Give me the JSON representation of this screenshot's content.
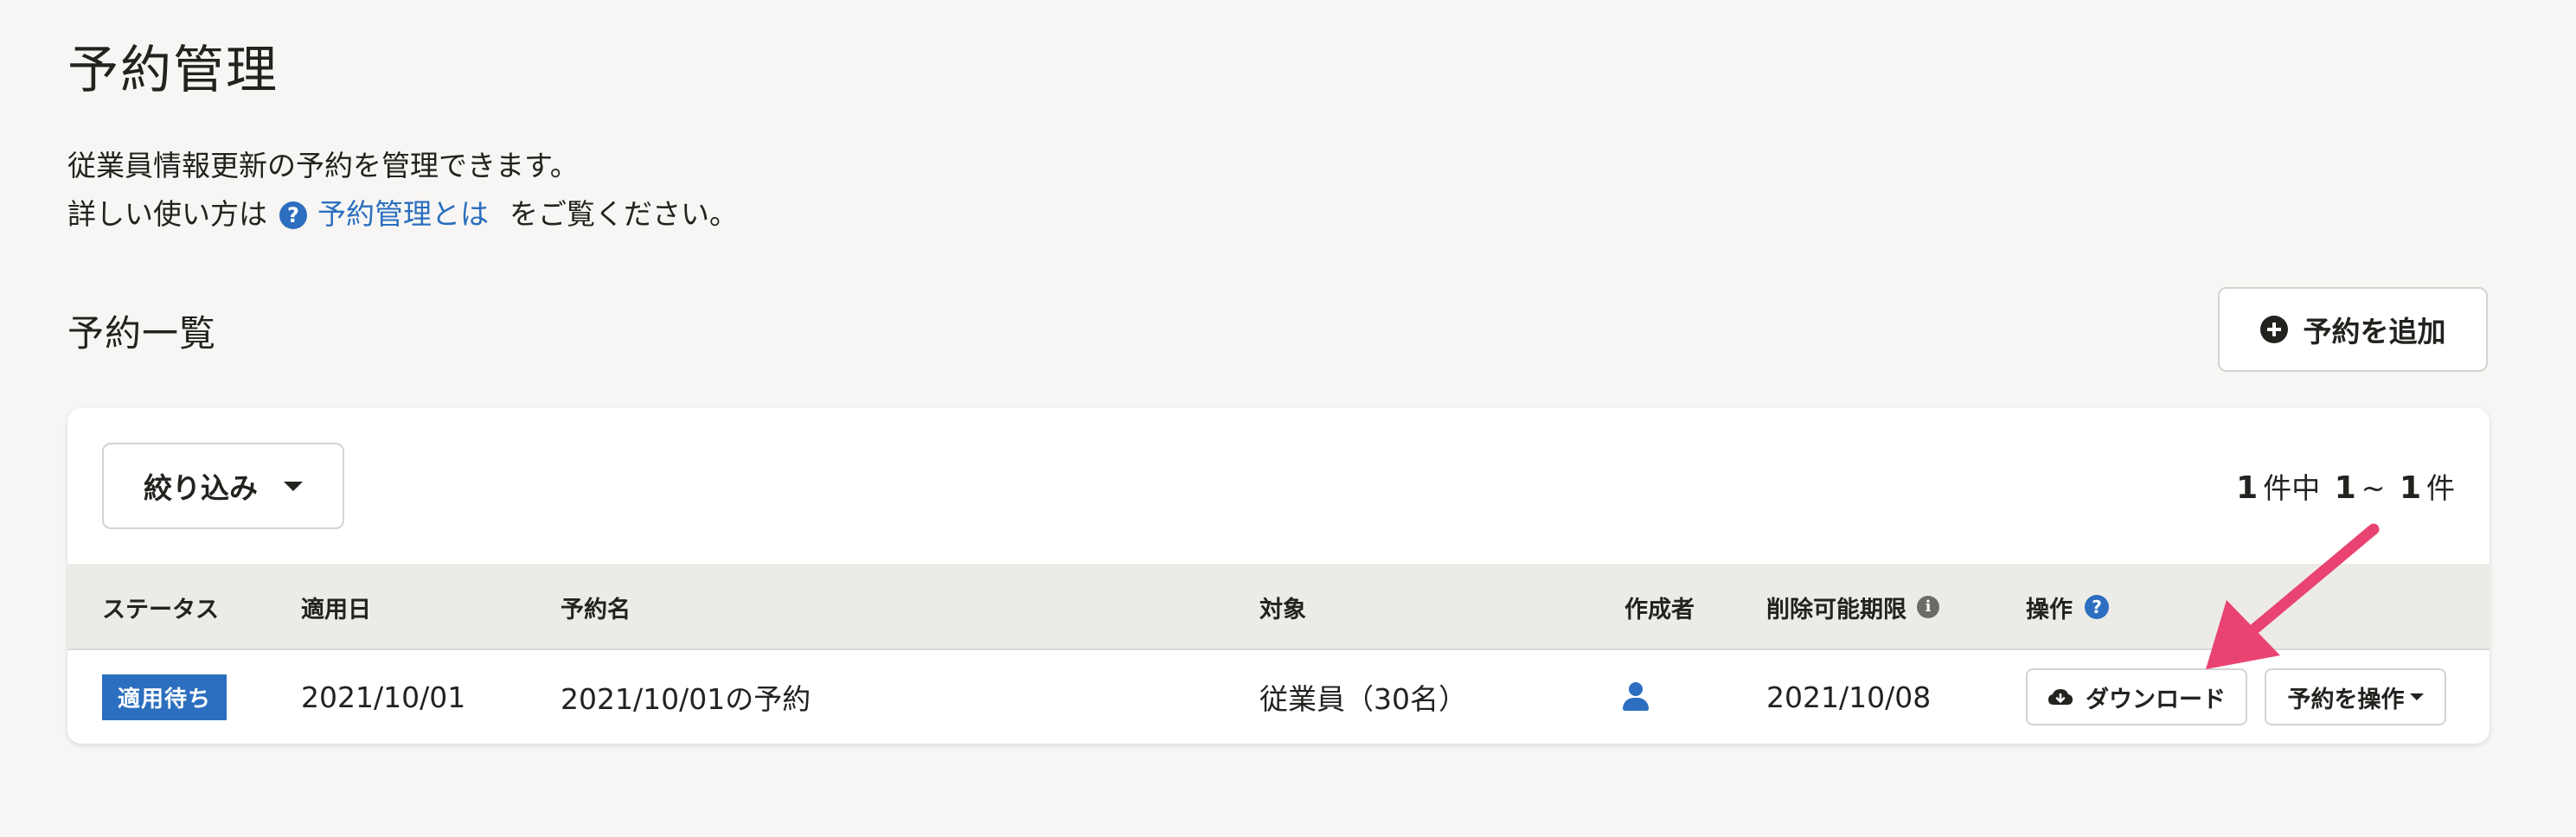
{
  "page": {
    "title": "予約管理",
    "description_line1": "従業員情報更新の予約を管理できます。",
    "description_line2_prefix": "詳しい使い方は",
    "help_link": "予約管理とは",
    "description_line2_suffix": "をご覧ください。"
  },
  "section": {
    "title": "予約一覧",
    "add_button": "予約を追加"
  },
  "filter": {
    "label": "絞り込み"
  },
  "pagination": {
    "total": "1",
    "total_unit": "件中",
    "range_start": "1",
    "range_sep": "~",
    "range_end": "1",
    "range_unit": "件"
  },
  "table": {
    "headers": {
      "status": "ステータス",
      "apply_date": "適用日",
      "name": "予約名",
      "target": "対象",
      "creator": "作成者",
      "deletable_until": "削除可能期限",
      "actions": "操作"
    },
    "rows": [
      {
        "status": "適用待ち",
        "apply_date": "2021/10/01",
        "name": "2021/10/01の予約",
        "target": "従業員（30名）",
        "creator_icon": "person-icon",
        "deletable_until": "2021/10/08",
        "download_label": "ダウンロード",
        "operate_label": "予約を操作"
      }
    ]
  },
  "colors": {
    "accent": "#2c6ebf",
    "annotation_arrow": "#e94372",
    "background": "#f7f6f4"
  }
}
